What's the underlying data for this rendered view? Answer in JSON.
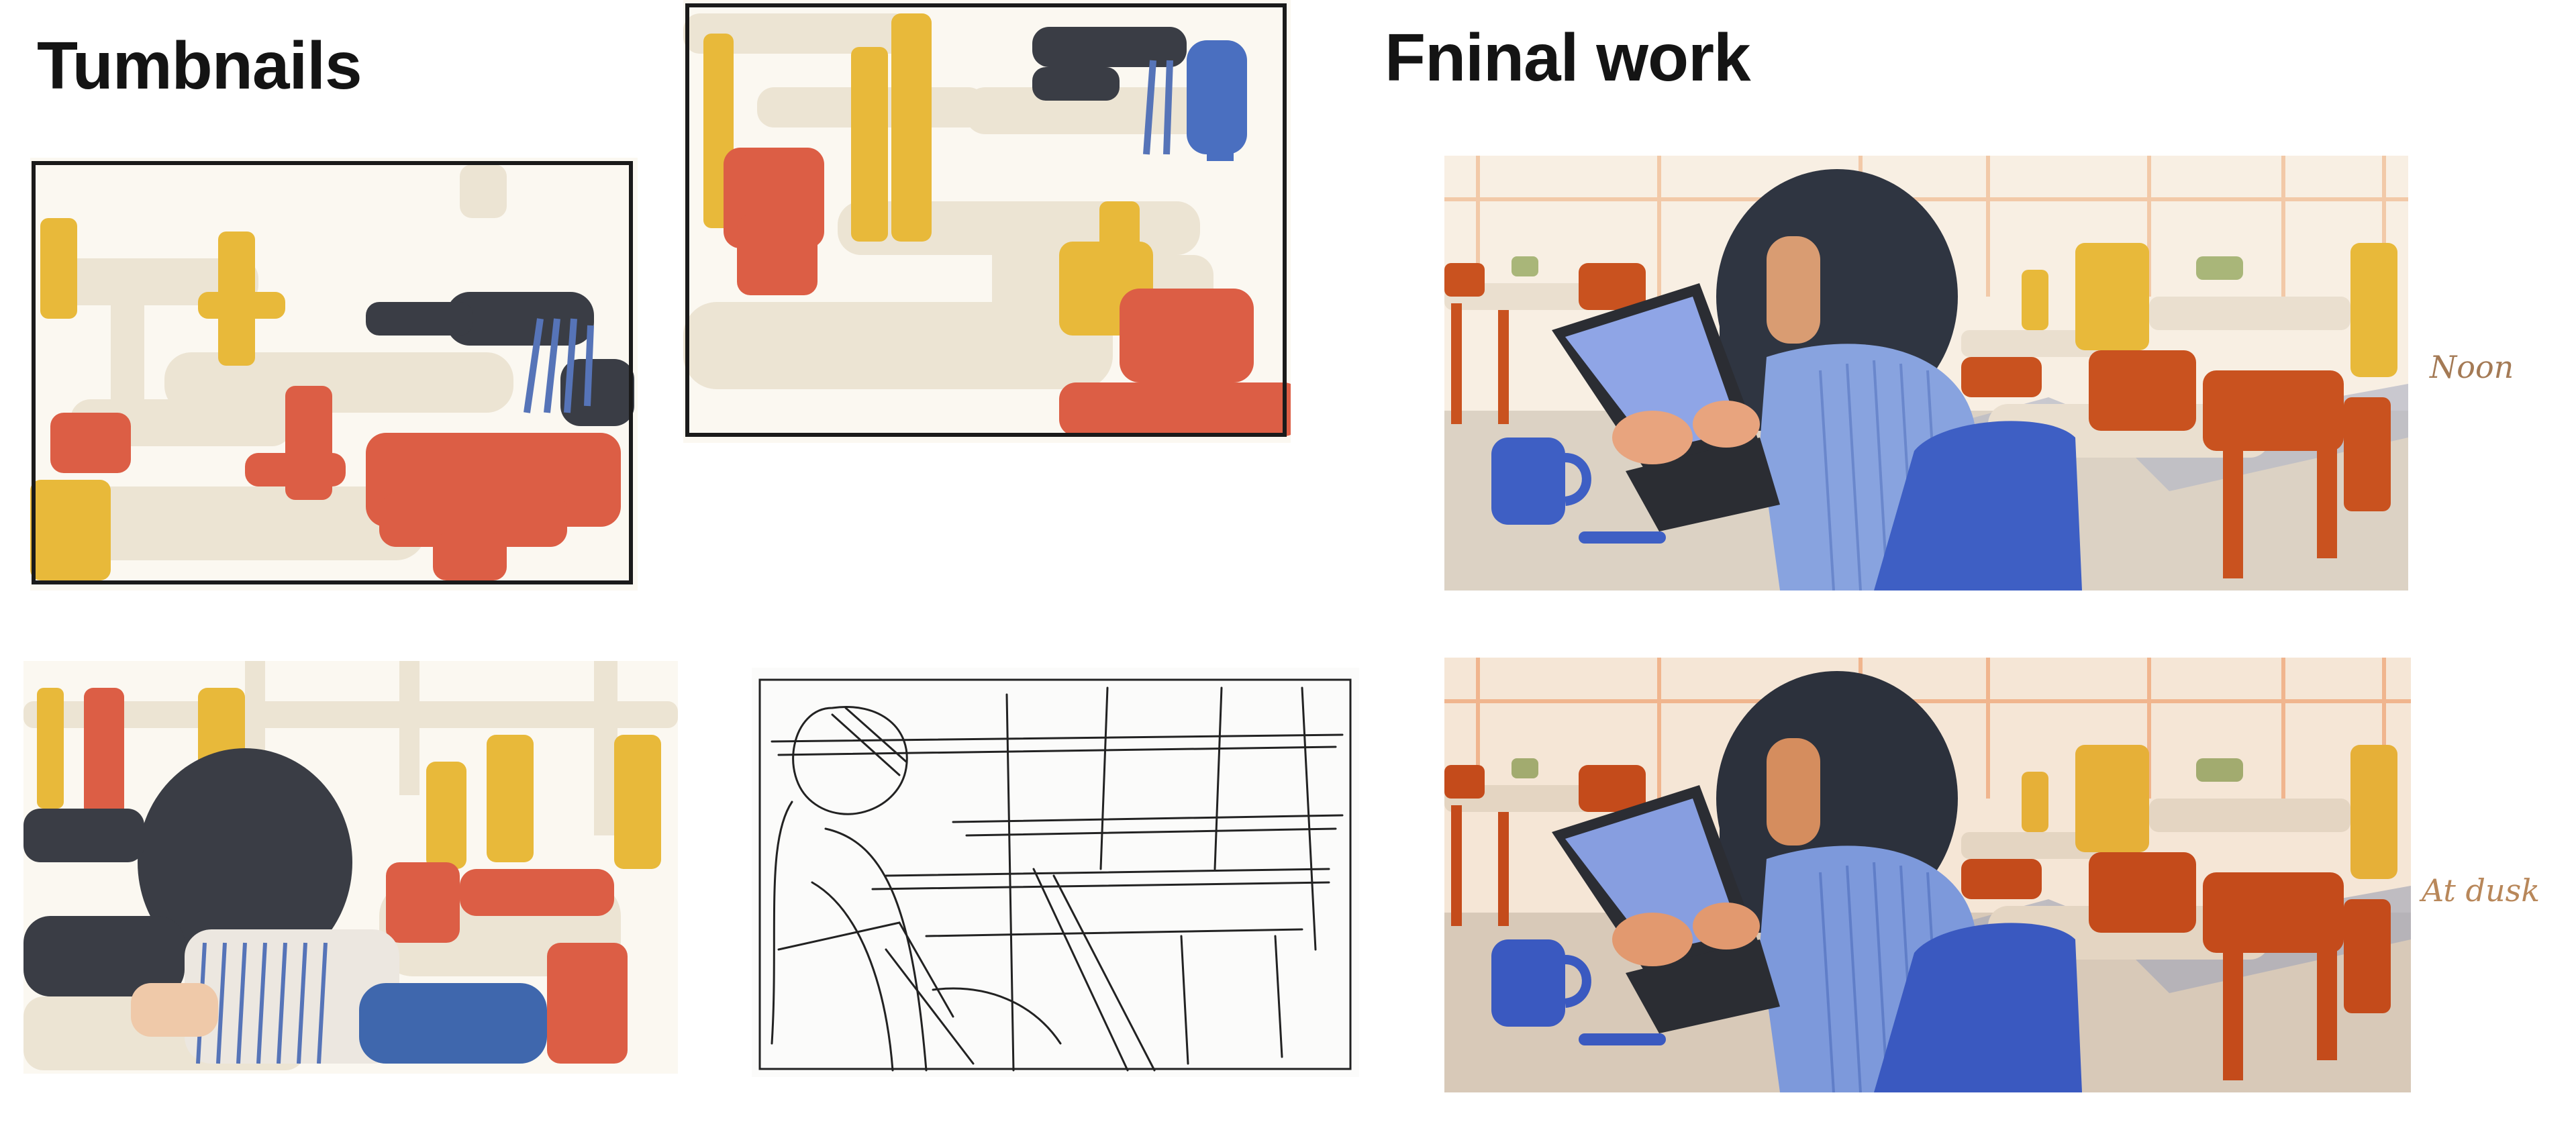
{
  "headings": {
    "left": "Tumbnails",
    "right": "Fninal work"
  },
  "time_labels": {
    "noon": "Noon",
    "dusk": "At dusk"
  },
  "colors": {
    "mustard": "#e8b93a",
    "tomato": "#dc5e45",
    "cream": "#ece4d3",
    "ink": "#3a3d45",
    "stripe_blue": "#5674b8",
    "royal_blue": "#3e5fc4",
    "rust": "#c9521f",
    "window_peach": "#f2c9a8"
  }
}
